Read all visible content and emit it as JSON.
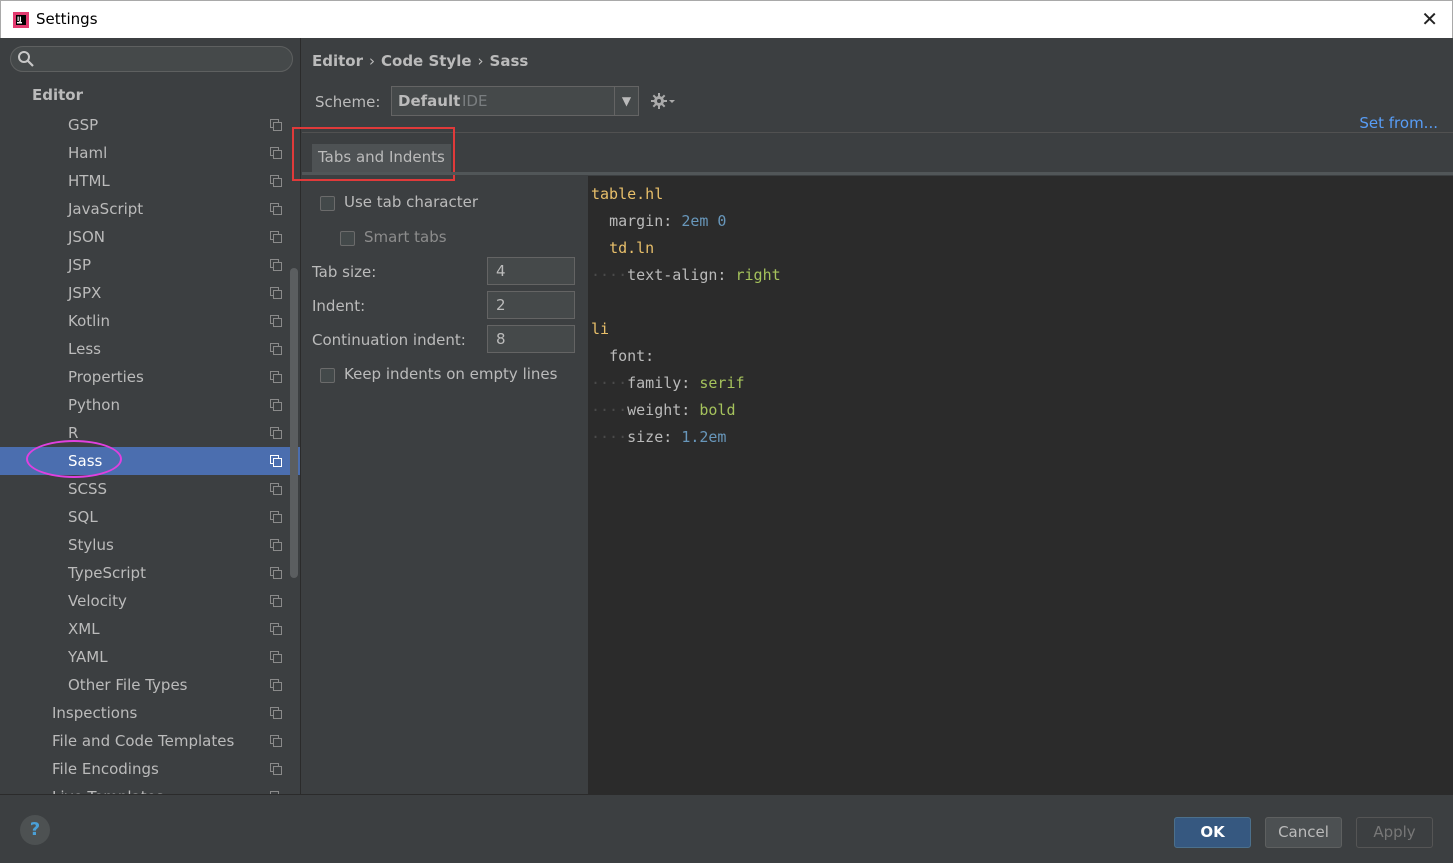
{
  "window": {
    "title": "Settings",
    "close_glyph": "✕"
  },
  "sidebar": {
    "search": {
      "placeholder": "",
      "value": ""
    },
    "heading": "Editor",
    "items": [
      {
        "label": "GSP",
        "level": "child"
      },
      {
        "label": "Haml",
        "level": "child"
      },
      {
        "label": "HTML",
        "level": "child"
      },
      {
        "label": "JavaScript",
        "level": "child"
      },
      {
        "label": "JSON",
        "level": "child"
      },
      {
        "label": "JSP",
        "level": "child"
      },
      {
        "label": "JSPX",
        "level": "child"
      },
      {
        "label": "Kotlin",
        "level": "child"
      },
      {
        "label": "Less",
        "level": "child"
      },
      {
        "label": "Properties",
        "level": "child"
      },
      {
        "label": "Python",
        "level": "child"
      },
      {
        "label": "R",
        "level": "child"
      },
      {
        "label": "Sass",
        "level": "child",
        "selected": true
      },
      {
        "label": "SCSS",
        "level": "child"
      },
      {
        "label": "SQL",
        "level": "child"
      },
      {
        "label": "Stylus",
        "level": "child"
      },
      {
        "label": "TypeScript",
        "level": "child"
      },
      {
        "label": "Velocity",
        "level": "child"
      },
      {
        "label": "XML",
        "level": "child"
      },
      {
        "label": "YAML",
        "level": "child"
      },
      {
        "label": "Other File Types",
        "level": "child"
      },
      {
        "label": "Inspections",
        "level": "top"
      },
      {
        "label": "File and Code Templates",
        "level": "top"
      },
      {
        "label": "File Encodings",
        "level": "top"
      },
      {
        "label": "Live Templates",
        "level": "top"
      }
    ]
  },
  "breadcrumb": {
    "parts": [
      "Editor",
      "Code Style",
      "Sass"
    ],
    "sep": "›"
  },
  "scheme": {
    "label": "Scheme:",
    "value": "Default",
    "sub": "IDE",
    "arrow": "▼"
  },
  "set_from_link": "Set from...",
  "tabs": [
    {
      "label": "Tabs and Indents",
      "active": true
    }
  ],
  "options": {
    "use_tab_character": {
      "label": "Use tab character",
      "checked": false
    },
    "smart_tabs": {
      "label": "Smart tabs",
      "checked": false,
      "disabled": true
    },
    "tab_size": {
      "label": "Tab size:",
      "value": "4"
    },
    "indent": {
      "label": "Indent:",
      "value": "2"
    },
    "continuation_indent": {
      "label": "Continuation indent:",
      "value": "8"
    },
    "keep_indents": {
      "label": "Keep indents on empty lines",
      "checked": false
    }
  },
  "preview": {
    "lines": [
      {
        "ws": "",
        "parts": [
          [
            "sel",
            "table.hl"
          ]
        ]
      },
      {
        "ws": "  ",
        "parts": [
          [
            "prop",
            "margin: "
          ],
          [
            "num",
            "2em 0"
          ]
        ]
      },
      {
        "ws": "  ",
        "parts": [
          [
            "sel",
            "td.ln"
          ]
        ]
      },
      {
        "ws": "····",
        "parts": [
          [
            "prop",
            "text-align: "
          ],
          [
            "kw",
            "right"
          ]
        ]
      },
      {
        "ws": "",
        "parts": []
      },
      {
        "ws": "",
        "parts": [
          [
            "sel",
            "li"
          ]
        ]
      },
      {
        "ws": "  ",
        "parts": [
          [
            "prop",
            "font:"
          ]
        ]
      },
      {
        "ws": "····",
        "parts": [
          [
            "prop",
            "family: "
          ],
          [
            "kw",
            "serif"
          ]
        ]
      },
      {
        "ws": "····",
        "parts": [
          [
            "prop",
            "weight: "
          ],
          [
            "kw",
            "bold"
          ]
        ]
      },
      {
        "ws": "····",
        "parts": [
          [
            "prop",
            "size: "
          ],
          [
            "num",
            "1.2em"
          ]
        ]
      }
    ]
  },
  "footer": {
    "help": "?",
    "ok": "OK",
    "cancel": "Cancel",
    "apply": "Apply"
  },
  "colors": {
    "accent_selection": "#4b6eaf",
    "link": "#589df6",
    "ok_button": "#365880",
    "tab_highlight_border": "#e03a3a",
    "sidebar_circle": "#e040e0"
  }
}
